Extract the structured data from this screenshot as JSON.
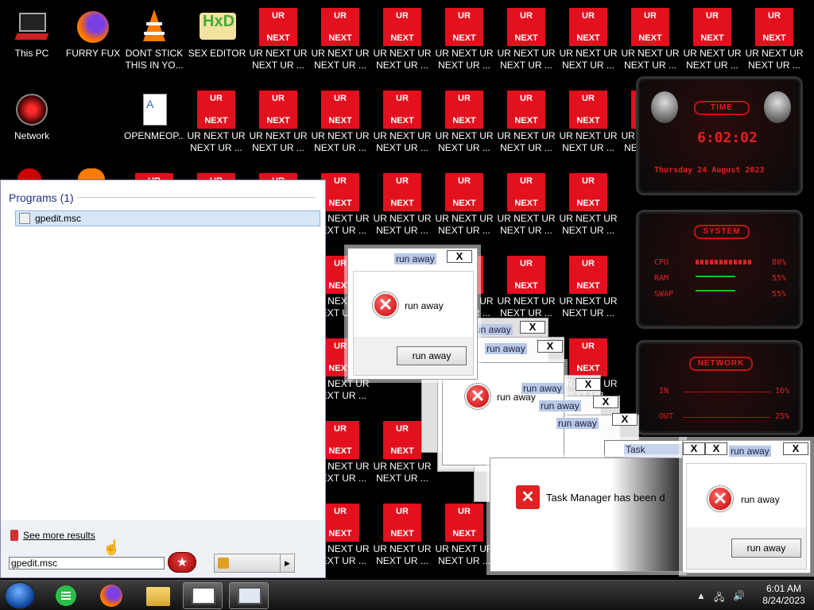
{
  "desktop": {
    "icons": [
      {
        "name": "this-pc-icon",
        "label": "This PC"
      },
      {
        "name": "firefox-icon",
        "label": "FURRY FUX"
      },
      {
        "name": "vlc-icon",
        "label": "DONT STICK\nTHIS IN YO..."
      },
      {
        "name": "hxd-icon",
        "label": "SEX EDITOR"
      },
      {
        "name": "network-icon",
        "label": "Network"
      },
      {
        "name": "document-icon",
        "label": "OPENMEOP..."
      }
    ],
    "ur_icon": {
      "top": "UR",
      "bottom": "NEXT",
      "label1": "UR NEXT UR",
      "label2": "NEXT UR ..."
    }
  },
  "gadget": {
    "time_title": "TIME",
    "time": "6:02:02",
    "date": "Thursday 24 August 2023",
    "system_title": "SYSTEM",
    "cpu_label": "CPU",
    "cpu_value": "80%",
    "cpu_level": 0.8,
    "ram_label": "RAM",
    "ram_value": "55%",
    "ram_level": 0.55,
    "swap_label": "SWAP",
    "swap_value": "55%",
    "swap_level": 0.55,
    "network_title": "NETWORK",
    "in_label": "IN",
    "in_value": "16%",
    "out_label": "OUT",
    "out_value": "25%",
    "accent": "#e02020"
  },
  "start_menu": {
    "programs_header": "Programs (1)",
    "program": "gpedit.msc",
    "see_more": "See more results",
    "search_value": "gpedit.msc"
  },
  "dialogs": {
    "title": "run away",
    "message": "run away",
    "button": "run away",
    "close": "X",
    "task_manager_title": "Task Manager",
    "task_manager_msg": "Task Manager has been d"
  },
  "taskbar": {
    "time": "6:01 AM",
    "date": "8/24/2023"
  }
}
